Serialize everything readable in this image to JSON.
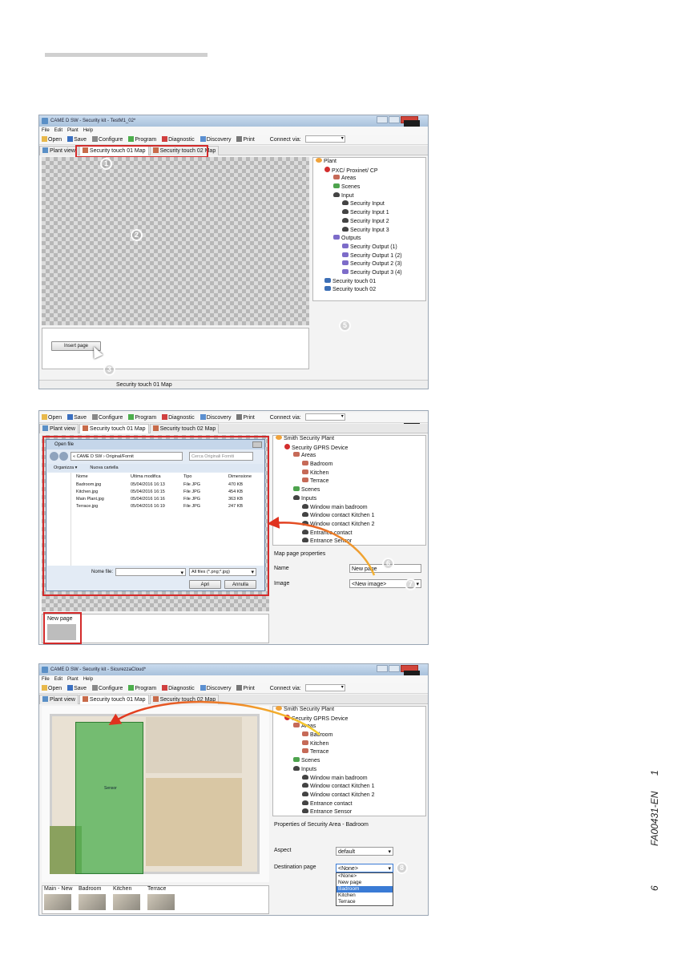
{
  "page": {
    "doc_code": "FA00431-EN",
    "page_number": "6",
    "revision": "1"
  },
  "shot1": {
    "window_title": "CAME D SW - Security kit - TestM1_02*",
    "menu": [
      "File",
      "Edit",
      "Plant",
      "Help"
    ],
    "toolbar": [
      "Open",
      "Save",
      "Configure",
      "Program",
      "Diagnostic",
      "Discovery",
      "Print"
    ],
    "connect_label": "Connect via:",
    "tabs": [
      "Plant view",
      "Security touch 01 Map",
      "Security touch 02 Map"
    ],
    "tree": [
      {
        "label": "Plant",
        "level": 0,
        "icon": "plant-icon"
      },
      {
        "label": "PXC/ Proxinet/ CP",
        "level": 1,
        "icon": "device-icon"
      },
      {
        "label": "Areas",
        "level": 2,
        "icon": "areas-icon"
      },
      {
        "label": "Scenes",
        "level": 2,
        "icon": "scenes-icon"
      },
      {
        "label": "Input",
        "level": 2,
        "icon": "input-icon"
      },
      {
        "label": "Security Input",
        "level": 3,
        "icon": "input-icon"
      },
      {
        "label": "Security Input 1",
        "level": 3,
        "icon": "input-icon"
      },
      {
        "label": "Security Input 2",
        "level": 3,
        "icon": "input-icon"
      },
      {
        "label": "Security Input 3",
        "level": 3,
        "icon": "input-icon"
      },
      {
        "label": "Outputs",
        "level": 2,
        "icon": "outputs-icon"
      },
      {
        "label": "Security Output (1)",
        "level": 3,
        "icon": "output-icon"
      },
      {
        "label": "Security Output 1 (2)",
        "level": 3,
        "icon": "output-icon"
      },
      {
        "label": "Security Output 2 (3)",
        "level": 3,
        "icon": "output-icon"
      },
      {
        "label": "Security Output 3 (4)",
        "level": 3,
        "icon": "output-icon"
      },
      {
        "label": "Security touch 01",
        "level": 1,
        "icon": "touch-icon"
      },
      {
        "label": "Security touch 02",
        "level": 1,
        "icon": "touch-icon"
      }
    ],
    "insert_page": "Insert page",
    "status": "Security touch 01 Map",
    "markers": [
      "1",
      "2",
      "3",
      "5"
    ]
  },
  "shot2": {
    "toolbar": [
      "Open",
      "Save",
      "Configure",
      "Program",
      "Diagnostic",
      "Discovery",
      "Print"
    ],
    "connect_label": "Connect via:",
    "tabs": [
      "Plant view",
      "Security touch 01 Map",
      "Security touch 02 Map"
    ],
    "dialog": {
      "title": "Open file",
      "path": "« CAME D SW › Original/Fornit",
      "search": "Cerca Originali Forniti",
      "organize": "Organizza ▾",
      "new_folder": "Nuova cartella",
      "columns": [
        "Nome",
        "Ultima modifica",
        "Tipo",
        "Dimensione"
      ],
      "files": [
        [
          "Badroom.jpg",
          "05/04/2016 16:13",
          "File JPG",
          "470 KB"
        ],
        [
          "Kitchen.jpg",
          "05/04/2016 16:15",
          "File JPG",
          "454 KB"
        ],
        [
          "Main Plant.jpg",
          "05/04/2016 16:16",
          "File JPG",
          "363 KB"
        ],
        [
          "Terrace.jpg",
          "05/04/2016 16:19",
          "File JPG",
          "247 KB"
        ]
      ],
      "file_name_label": "Nome file:",
      "filter": "All files (*.png;*.jpg)",
      "open": "Apri",
      "cancel": "Annulla"
    },
    "tree": [
      {
        "label": "Smith Security Plant",
        "level": 0,
        "icon": "plant-icon"
      },
      {
        "label": "Security GPRS Device",
        "level": 1,
        "icon": "device-icon"
      },
      {
        "label": "Areas",
        "level": 2,
        "icon": "areas-icon"
      },
      {
        "label": "Badroom",
        "level": 3,
        "icon": "area-icon"
      },
      {
        "label": "Kitchen",
        "level": 3,
        "icon": "area-icon"
      },
      {
        "label": "Terrace",
        "level": 3,
        "icon": "area-icon"
      },
      {
        "label": "Scenes",
        "level": 2,
        "icon": "scenes-icon"
      },
      {
        "label": "Inputs",
        "level": 2,
        "icon": "input-icon"
      },
      {
        "label": "Window main badroom",
        "level": 3,
        "icon": "input-icon"
      },
      {
        "label": "Window contact Kitchen 1",
        "level": 3,
        "icon": "input-icon"
      },
      {
        "label": "Window contact Kitchen 2",
        "level": 3,
        "icon": "input-icon"
      },
      {
        "label": "Entrance contact",
        "level": 3,
        "icon": "input-icon"
      },
      {
        "label": "Entrance Sensor",
        "level": 3,
        "icon": "input-icon"
      }
    ],
    "props_title": "Map page properties",
    "name_label": "Name",
    "name_value": "New page",
    "image_label": "Image",
    "image_value": "<New image>",
    "new_page": "New page",
    "markers": [
      "6",
      "7"
    ]
  },
  "shot3": {
    "window_title": "CAME D SW - Security kit - SicurezzaCloud*",
    "menu": [
      "File",
      "Edit",
      "Plant",
      "Help"
    ],
    "toolbar": [
      "Open",
      "Save",
      "Configure",
      "Program",
      "Diagnostic",
      "Discovery",
      "Print"
    ],
    "connect_label": "Connect via:",
    "tabs": [
      "Plant view",
      "Security touch 01 Map",
      "Security touch 02 Map"
    ],
    "tree": [
      {
        "label": "Smith Security Plant",
        "level": 0,
        "icon": "plant-icon"
      },
      {
        "label": "Security GPRS Device",
        "level": 1,
        "icon": "device-icon"
      },
      {
        "label": "Areas",
        "level": 2,
        "icon": "areas-icon"
      },
      {
        "label": "Badroom",
        "level": 3,
        "icon": "area-icon"
      },
      {
        "label": "Kitchen",
        "level": 3,
        "icon": "area-icon"
      },
      {
        "label": "Terrace",
        "level": 3,
        "icon": "area-icon"
      },
      {
        "label": "Scenes",
        "level": 2,
        "icon": "scenes-icon"
      },
      {
        "label": "Inputs",
        "level": 2,
        "icon": "input-icon"
      },
      {
        "label": "Window main badroom",
        "level": 3,
        "icon": "input-icon"
      },
      {
        "label": "Window contact Kitchen 1",
        "level": 3,
        "icon": "input-icon"
      },
      {
        "label": "Window contact Kitchen 2",
        "level": 3,
        "icon": "input-icon"
      },
      {
        "label": "Entrance contact",
        "level": 3,
        "icon": "input-icon"
      },
      {
        "label": "Entrance Sensor",
        "level": 3,
        "icon": "input-icon"
      }
    ],
    "props_title": "Properties of Security Area - Badroom",
    "aspect_label": "Aspect",
    "aspect_value": "default",
    "dest_label": "Destination page",
    "dest_value": "<None>",
    "dest_options": [
      "<None>",
      "New page",
      "Badroom",
      "Kitchen",
      "Terrace"
    ],
    "dest_selected": "Badroom",
    "sensor_label": "Sensor",
    "thumbs": [
      "Main - New",
      "Badroom",
      "Kitchen",
      "Terrace"
    ],
    "markers": [
      "8"
    ]
  }
}
